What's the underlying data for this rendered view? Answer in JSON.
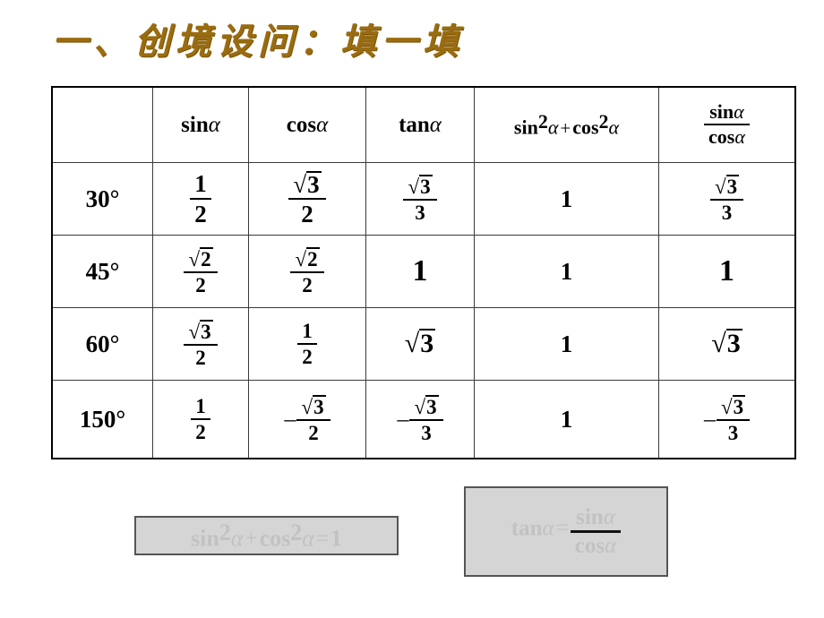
{
  "slide": {
    "title": "一、创境设问：填一填",
    "title_color": "#9a6c10",
    "background": "#ffffff"
  },
  "table": {
    "border_color": "#3a3a3a",
    "columns": [
      {
        "key": "angle",
        "label": ""
      },
      {
        "key": "sin",
        "label": "sin α"
      },
      {
        "key": "cos",
        "label": "cos α"
      },
      {
        "key": "tan",
        "label": "tan α"
      },
      {
        "key": "pyth",
        "label": "sin² α + cos² α"
      },
      {
        "key": "ratio",
        "label": "sin α / cos α"
      }
    ],
    "header": {
      "empty": "",
      "sin_fn": "sin",
      "sin_arg": "α",
      "cos_fn": "cos",
      "cos_arg": "α",
      "tan_fn": "tan",
      "tan_arg": "α",
      "pyth_fn1": "sin",
      "pyth_sup1": "2",
      "pyth_arg1": "α",
      "pyth_op": "+",
      "pyth_fn2": "cos",
      "pyth_sup2": "2",
      "pyth_arg2": "α",
      "ratio_num_fn": "sin",
      "ratio_num_arg": "α",
      "ratio_den_fn": "cos",
      "ratio_den_arg": "α"
    },
    "rows": [
      {
        "angle": "30°",
        "sin": {
          "type": "fraction",
          "num": "1",
          "den": "2"
        },
        "cos": {
          "type": "fraction",
          "num": "√3",
          "den": "2"
        },
        "tan": {
          "type": "fraction",
          "num": "√3",
          "den": "3"
        },
        "pyth": {
          "type": "value",
          "text": "1"
        },
        "ratio": {
          "type": "fraction",
          "num": "√3",
          "den": "3"
        }
      },
      {
        "angle": "45°",
        "sin": {
          "type": "fraction",
          "num": "√2",
          "den": "2"
        },
        "cos": {
          "type": "fraction",
          "num": "√2",
          "den": "2"
        },
        "tan": {
          "type": "value",
          "text": "1"
        },
        "pyth": {
          "type": "value",
          "text": "1"
        },
        "ratio": {
          "type": "value",
          "text": "1"
        }
      },
      {
        "angle": "60°",
        "sin": {
          "type": "fraction",
          "num": "√3",
          "den": "2"
        },
        "cos": {
          "type": "fraction",
          "num": "1",
          "den": "2"
        },
        "tan": {
          "type": "radical",
          "text": "√3"
        },
        "pyth": {
          "type": "value",
          "text": "1"
        },
        "ratio": {
          "type": "radical",
          "text": "√3"
        }
      },
      {
        "angle": "150°",
        "sin": {
          "type": "fraction",
          "num": "1",
          "den": "2",
          "sign": ""
        },
        "cos": {
          "type": "fraction",
          "num": "√3",
          "den": "2",
          "sign": "–"
        },
        "tan": {
          "type": "fraction",
          "num": "√3",
          "den": "3",
          "sign": "–"
        },
        "pyth": {
          "type": "value",
          "text": "1"
        },
        "ratio": {
          "type": "fraction",
          "num": "√3",
          "den": "3",
          "sign": "–"
        }
      }
    ],
    "cells": {
      "r0": {
        "angle": "30°",
        "sin_num": "1",
        "sin_den": "2",
        "cos_num": "3",
        "cos_den": "2",
        "tan_num": "3",
        "tan_den": "3",
        "pyth": "1",
        "ratio_num": "3",
        "ratio_den": "3"
      },
      "r1": {
        "angle": "45°",
        "sin_num": "2",
        "sin_den": "2",
        "cos_num": "2",
        "cos_den": "2",
        "tan": "1",
        "pyth": "1",
        "ratio": "1"
      },
      "r2": {
        "angle": "60°",
        "sin_num": "3",
        "sin_den": "2",
        "cos_num": "1",
        "cos_den": "2",
        "tan": "3",
        "pyth": "1",
        "ratio": "3"
      },
      "r3": {
        "angle": "150°",
        "sin_num": "1",
        "sin_den": "2",
        "cos_sign": "–",
        "cos_num": "3",
        "cos_den": "2",
        "tan_sign": "–",
        "tan_num": "3",
        "tan_den": "3",
        "pyth": "1",
        "ratio_sign": "–",
        "ratio_num": "3",
        "ratio_den": "3"
      }
    }
  },
  "callouts": {
    "background": "#d5d5d5",
    "border_color": "#555555",
    "text_color": "#c2c2c2",
    "pythagorean": {
      "text": "sin² α + cos² α = 1",
      "fn1": "sin",
      "sup1": "2",
      "arg1": "α",
      "op_plus": "+",
      "fn2": "cos",
      "sup2": "2",
      "arg2": "α",
      "op_eq": "=",
      "result": "1"
    },
    "tan_identity": {
      "text": "tan α = sin α / cos α",
      "fn": "tan",
      "arg": "α",
      "op_eq": "=",
      "num_fn": "sin",
      "num_arg": "α",
      "den_fn": "cos",
      "den_arg": "α"
    }
  }
}
